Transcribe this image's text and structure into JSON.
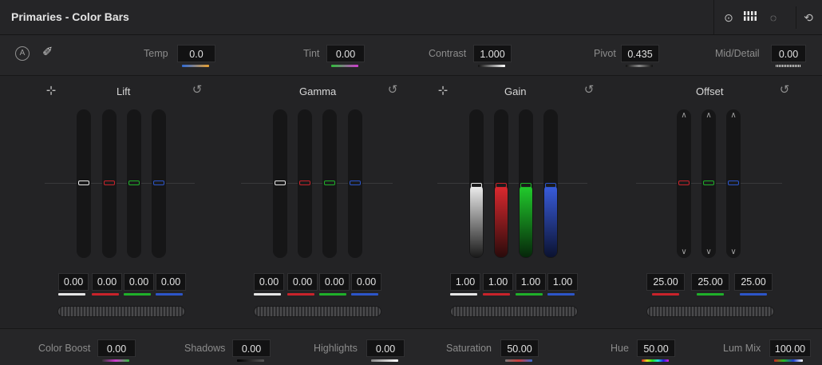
{
  "header": {
    "title": "Primaries - Color Bars",
    "icons": [
      "color-wheels-icon",
      "bars-icon",
      "log-wheels-icon",
      "reset-all-icon"
    ]
  },
  "params": {
    "temp": {
      "label": "Temp",
      "value": "0.0"
    },
    "tint": {
      "label": "Tint",
      "value": "0.00"
    },
    "contrast": {
      "label": "Contrast",
      "value": "1.000"
    },
    "pivot": {
      "label": "Pivot",
      "value": "0.435"
    },
    "middetail": {
      "label": "Mid/Detail",
      "value": "0.00"
    }
  },
  "wheels": {
    "lift": {
      "title": "Lift",
      "values": [
        "0.00",
        "0.00",
        "0.00",
        "0.00"
      ]
    },
    "gamma": {
      "title": "Gamma",
      "values": [
        "0.00",
        "0.00",
        "0.00",
        "0.00"
      ]
    },
    "gain": {
      "title": "Gain",
      "values": [
        "1.00",
        "1.00",
        "1.00",
        "1.00"
      ]
    },
    "offset": {
      "title": "Offset",
      "values": [
        "25.00",
        "25.00",
        "25.00"
      ]
    }
  },
  "bottom": {
    "colorboost": {
      "label": "Color Boost",
      "value": "0.00"
    },
    "shadows": {
      "label": "Shadows",
      "value": "0.00"
    },
    "highlights": {
      "label": "Highlights",
      "value": "0.00"
    },
    "saturation": {
      "label": "Saturation",
      "value": "50.00"
    },
    "hue": {
      "label": "Hue",
      "value": "50.00"
    },
    "lummix": {
      "label": "Lum Mix",
      "value": "100.00"
    }
  },
  "colors": {
    "y": "#e6e6e6",
    "r": "#c8232b",
    "g": "#1fb02a",
    "b": "#2c55c8"
  }
}
